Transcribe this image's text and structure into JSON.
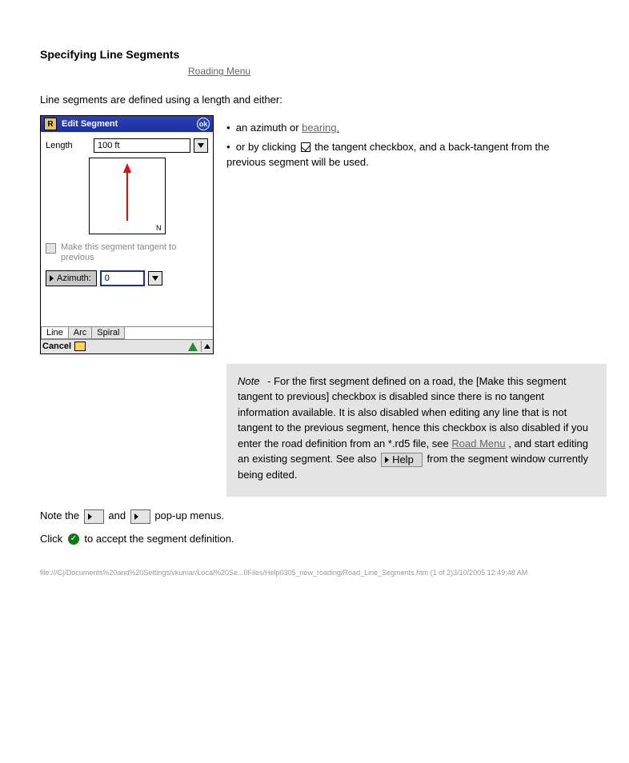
{
  "heading": "Specifying Line Segments",
  "sub_link": "Roading Menu",
  "intro_paragraph": "Line segments are defined using a length and either:",
  "right_text": {
    "line1a": "an azimuth or",
    "line1b": "bearing,",
    "line2a": "or by clicking",
    "line2b": "the tangent checkbox, and a back-tangent from the previous segment will be used.",
    "checkbox_alt": "checked"
  },
  "note": {
    "label": "Note",
    "sentence_part1": " - For the first segment defined on a road, the [Make this segment tangent to previous] checkbox is disabled since there is no tangent information available. It is also disabled when editing any line that is not tangent to the previous segment, hence this checkbox is also disabled if you enter the road definition from an *.rd5 file, see ",
    "road_menu_link": "Road Menu",
    "sentence_part2": ", and start editing an existing segment. See also ",
    "help_link_label": "Help",
    "help_link_text": " from the segment window currently being edited."
  },
  "cont": {
    "p1_part1": "Note the ",
    "p1_part2": " and ",
    "p1_part3": " pop-up menus.",
    "p2_part1": "Click ",
    "p2_part2": " to accept the segment definition."
  },
  "popup_btns": {
    "left": "",
    "right": ""
  },
  "window": {
    "title": "Edit Segment",
    "ok": "ok",
    "length_label": "Length",
    "length_value": "100 ft",
    "preview_n": "N",
    "tangent_text": "Make this segment tangent to previous",
    "azimuth_label": "Azimuth:",
    "azimuth_value": "0",
    "tabs": {
      "line": "Line",
      "arc": "Arc",
      "spiral": "Spiral"
    },
    "cancel": "Cancel"
  },
  "footer": {
    "left": "file:///C|/Documents%20and%20Settings/vkumar/Local%20Se...0Files/Help0305_new_roading/Road_Line_Segments.htm (1 of 2)3/10/2005 12:49:48 AM"
  }
}
